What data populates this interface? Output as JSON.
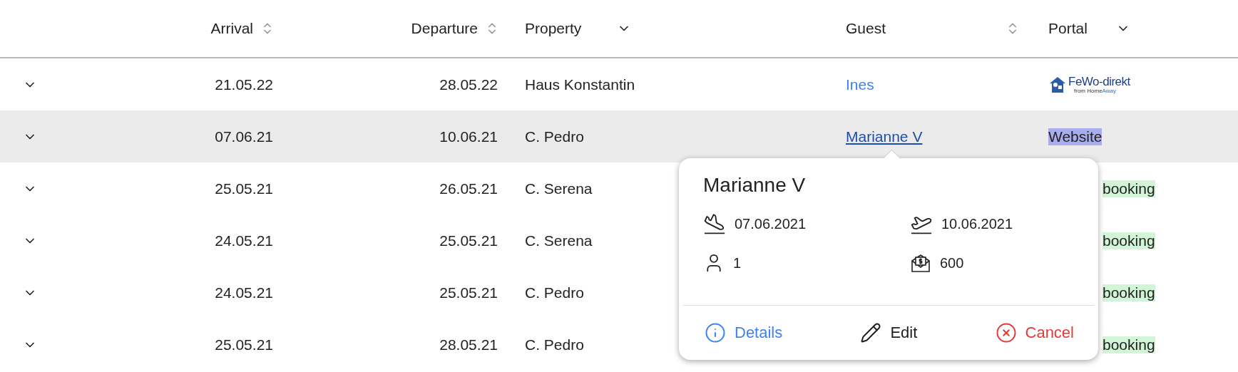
{
  "columns": [
    {
      "label": "Arrival",
      "kind": "sort"
    },
    {
      "label": "Departure",
      "kind": "sort"
    },
    {
      "label": "Property",
      "kind": "dropdown"
    },
    {
      "label": "Guest",
      "kind": "sort"
    },
    {
      "label": "Portal",
      "kind": "dropdown"
    }
  ],
  "rows": [
    {
      "selected": false,
      "arrival": "21.05.22",
      "departure": "28.05.22",
      "property": "Haus Konstantin",
      "guest": "Ines",
      "portal": {
        "kind": "logo",
        "name": "FeWo-direkt",
        "sub_prefix": "from ",
        "sub_brand": "Home",
        "sub_brand2": "Away"
      }
    },
    {
      "selected": true,
      "arrival": "07.06.21",
      "departure": "10.06.21",
      "property": "C. Pedro",
      "guest": "Marianne V",
      "portal": {
        "kind": "highlighted",
        "text": "Website"
      }
    },
    {
      "selected": false,
      "arrival": "25.05.21",
      "departure": "26.05.21",
      "property": "C. Serena",
      "portal": {
        "kind": "tag",
        "text": "booking"
      }
    },
    {
      "selected": false,
      "arrival": "24.05.21",
      "departure": "25.05.21",
      "property": "C. Serena",
      "portal": {
        "kind": "tag",
        "text": "booking"
      }
    },
    {
      "selected": false,
      "arrival": "24.05.21",
      "departure": "25.05.21",
      "property": "C. Pedro",
      "portal": {
        "kind": "tag",
        "text": "booking"
      }
    },
    {
      "selected": false,
      "arrival": "25.05.21",
      "departure": "28.05.21",
      "property": "C. Pedro",
      "portal": {
        "kind": "tag",
        "text": "booking"
      }
    }
  ],
  "popup": {
    "title": "Marianne V",
    "arrival": "07.06.2021",
    "departure": "10.06.2021",
    "guests": "1",
    "price": "600",
    "actions": [
      {
        "kind": "details",
        "label": "Details"
      },
      {
        "kind": "edit",
        "label": "Edit"
      },
      {
        "kind": "cancel",
        "label": "Cancel"
      }
    ]
  }
}
